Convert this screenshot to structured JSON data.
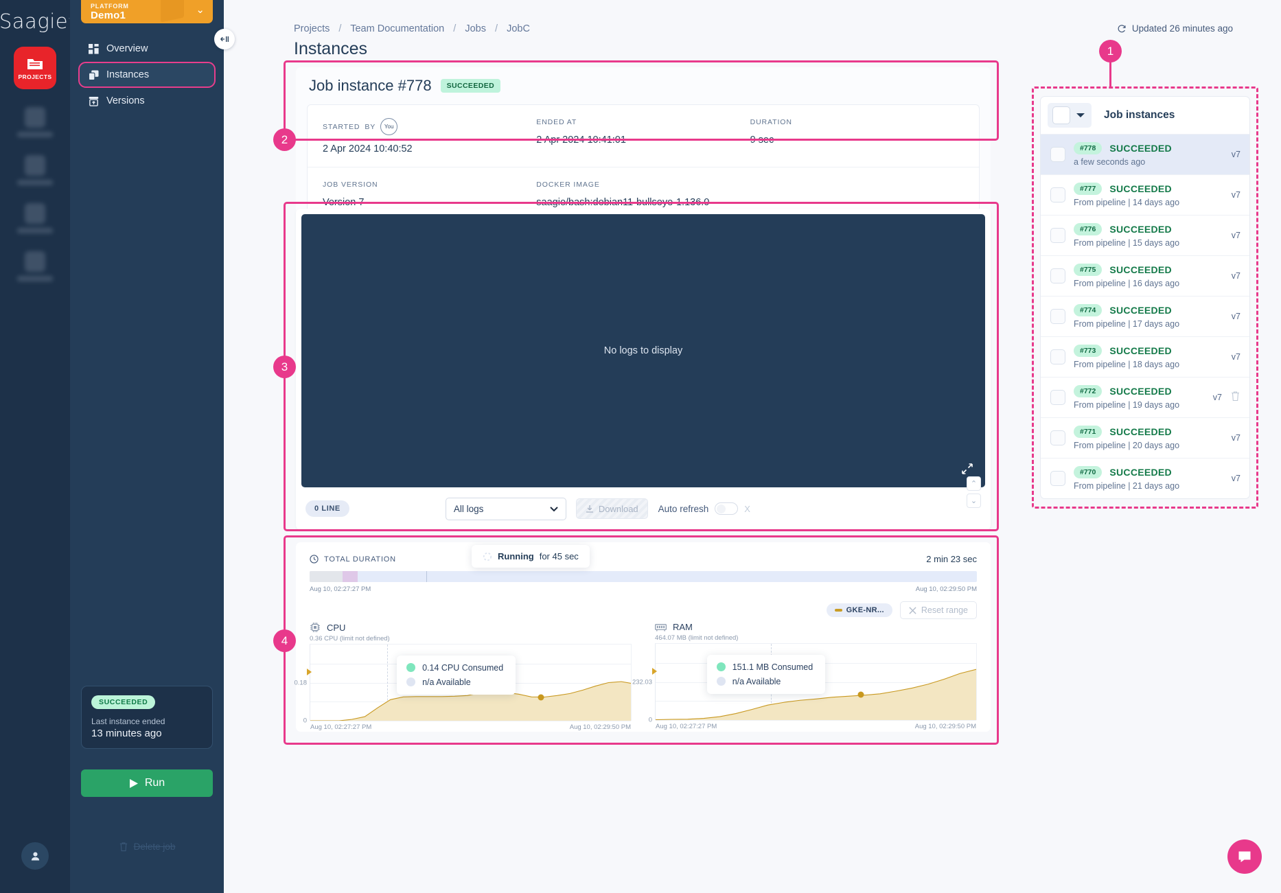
{
  "brand": {
    "logo": "Saagie",
    "projects_label": "PROJECTS"
  },
  "platform": {
    "kicker": "PLATFORM",
    "name": "Demo1"
  },
  "nav": {
    "items": [
      {
        "label": "Overview",
        "icon": "grid-icon"
      },
      {
        "label": "Instances",
        "icon": "layers-icon"
      },
      {
        "label": "Versions",
        "icon": "archive-upload-icon"
      }
    ]
  },
  "job_status": {
    "badge": "SUCCEEDED",
    "line1": "Last instance ended",
    "line2": "13 minutes ago",
    "run_label": "Run",
    "delete_label": "Delete job"
  },
  "header": {
    "breadcrumb": [
      "Projects",
      "Team Documentation",
      "Jobs",
      "JobC"
    ],
    "separator": "/",
    "page_title": "Instances",
    "updated": "Updated 26 minutes ago"
  },
  "instance": {
    "title": "Job instance #778",
    "status": "SUCCEEDED",
    "fields": {
      "started_label": "STARTED",
      "by_label": "BY",
      "by_value": "You",
      "started_value": "2 Apr 2024 10:40:52",
      "ended_label": "ENDED AT",
      "ended_value": "2 Apr 2024 10:41:01",
      "duration_label": "DURATION",
      "duration_value": "9 sec",
      "job_version_label": "JOB VERSION",
      "job_version_value": "Version 7",
      "docker_label": "DOCKER IMAGE",
      "docker_value": "saagie/bash:debian11-bullseye-1.136.0"
    }
  },
  "logs": {
    "empty_text": "No logs to display",
    "line_count": "0 LINE",
    "filter_selected": "All logs",
    "download_label": "Download",
    "auto_refresh_label": "Auto refresh",
    "auto_refresh_state": "X"
  },
  "metrics": {
    "total_duration_label": "TOTAL DURATION",
    "running_tip_bold": "Running",
    "running_tip_rest": "for 45 sec",
    "total_duration_value": "2 min 23 sec",
    "range_start": "Aug 10, 02:27:27 PM",
    "range_end": "Aug 10, 02:29:50 PM",
    "legend_label": "GKE-NR...",
    "reset_label": "Reset range"
  },
  "chart_data": [
    {
      "type": "area",
      "title": "CPU",
      "subtitle": "CPU (limit not defined)",
      "ylabel": "CPU",
      "ylim": [
        0,
        0.36
      ],
      "yticks": [
        "0",
        "0.18",
        "0.36"
      ],
      "xlabel": "",
      "xticks": [
        "Aug 10, 02:27:27 PM",
        "Aug 10, 02:29:50 PM"
      ],
      "grid": true,
      "legend": [
        "GKE-NR..."
      ],
      "tooltip": {
        "consumed": "0.14 CPU Consumed",
        "available": "n/a Available"
      },
      "series": [
        {
          "name": "Consumed",
          "x": [
            0,
            4,
            9,
            13,
            17,
            21,
            25,
            29,
            33,
            37,
            41,
            45,
            49,
            53,
            57,
            61,
            65,
            69,
            73,
            77,
            81,
            85,
            89,
            93,
            97,
            100
          ],
          "values": [
            0,
            0,
            0,
            0.005,
            0.02,
            0.06,
            0.098,
            0.112,
            0.114,
            0.114,
            0.114,
            0.115,
            0.118,
            0.132,
            0.133,
            0.133,
            0.125,
            0.113,
            0.112,
            0.118,
            0.128,
            0.143,
            0.163,
            0.181,
            0.186,
            0.176
          ]
        }
      ],
      "marker_point": {
        "x": 72,
        "y": 0.112
      },
      "hover_line_x": 24
    },
    {
      "type": "area",
      "title": "RAM",
      "subtitle": "MB (limit not defined)",
      "ylabel": "MB",
      "ylim": [
        0,
        464.07
      ],
      "yticks": [
        "0",
        "232.03",
        "464.07"
      ],
      "xlabel": "",
      "xticks": [
        "Aug 10, 02:27:27 PM",
        "Aug 10, 02:29:50 PM"
      ],
      "grid": true,
      "legend": [
        "GKE-NR..."
      ],
      "tooltip": {
        "consumed": "151.1 MB Consumed",
        "available": "n/a Available"
      },
      "series": [
        {
          "name": "Consumed",
          "x": [
            0,
            5,
            10,
            15,
            20,
            25,
            30,
            35,
            40,
            45,
            50,
            55,
            60,
            65,
            70,
            75,
            80,
            85,
            90,
            95,
            100
          ],
          "values": [
            2,
            3,
            5,
            10,
            20,
            38,
            62,
            88,
            105,
            118,
            128,
            138,
            145,
            151,
            160,
            175,
            192,
            215,
            245,
            280,
            305
          ]
        }
      ],
      "marker_point": {
        "x": 64,
        "y": 151.1
      },
      "hover_line_x": 36
    }
  ],
  "instances_panel": {
    "title": "Job instances",
    "rows": [
      {
        "number": "#778",
        "status": "SUCCEEDED",
        "sub": "a few seconds ago",
        "version": "v7",
        "selected": true,
        "has_delete": false
      },
      {
        "number": "#777",
        "status": "SUCCEEDED",
        "sub": "From pipeline | 14 days ago",
        "version": "v7",
        "selected": false,
        "has_delete": false
      },
      {
        "number": "#776",
        "status": "SUCCEEDED",
        "sub": "From pipeline | 15 days ago",
        "version": "v7",
        "selected": false,
        "has_delete": false
      },
      {
        "number": "#775",
        "status": "SUCCEEDED",
        "sub": "From pipeline | 16 days ago",
        "version": "v7",
        "selected": false,
        "has_delete": false
      },
      {
        "number": "#774",
        "status": "SUCCEEDED",
        "sub": "From pipeline | 17 days ago",
        "version": "v7",
        "selected": false,
        "has_delete": false
      },
      {
        "number": "#773",
        "status": "SUCCEEDED",
        "sub": "From pipeline | 18 days ago",
        "version": "v7",
        "selected": false,
        "has_delete": false
      },
      {
        "number": "#772",
        "status": "SUCCEEDED",
        "sub": "From pipeline | 19 days ago",
        "version": "v7",
        "selected": false,
        "has_delete": true
      },
      {
        "number": "#771",
        "status": "SUCCEEDED",
        "sub": "From pipeline | 20 days ago",
        "version": "v7",
        "selected": false,
        "has_delete": false
      },
      {
        "number": "#770",
        "status": "SUCCEEDED",
        "sub": "From pipeline | 21 days ago",
        "version": "v7",
        "selected": false,
        "has_delete": false
      }
    ]
  },
  "annotations": {
    "one": "1",
    "two": "2",
    "three": "3",
    "four": "4"
  },
  "colors": {
    "accent_pink": "#e8398b",
    "brand_dark": "#243d58",
    "success": "#147a49",
    "run_green": "#2aa367",
    "platform_orange": "#f0a028"
  }
}
